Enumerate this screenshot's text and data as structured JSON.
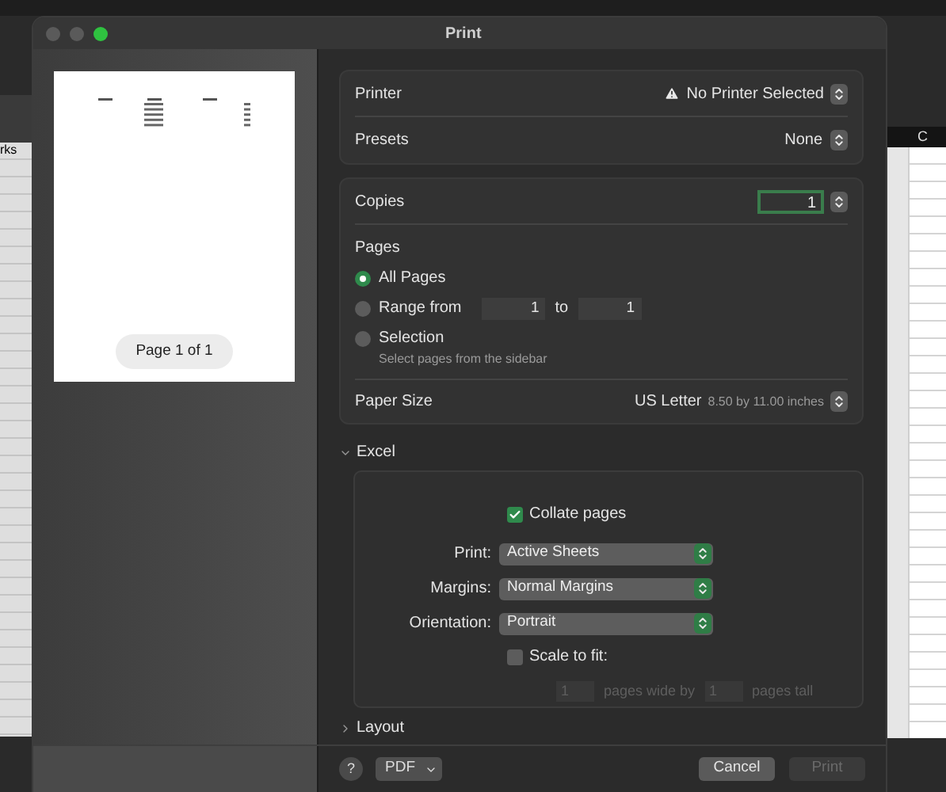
{
  "window": {
    "title": "Print"
  },
  "background": {
    "left_cell": "rks",
    "right_header": "C"
  },
  "preview": {
    "page_label": "Page 1 of 1"
  },
  "printer": {
    "label": "Printer",
    "value": "No Printer Selected",
    "warning": true
  },
  "presets": {
    "label": "Presets",
    "value": "None"
  },
  "copies": {
    "label": "Copies",
    "value": "1",
    "focused": true
  },
  "pages": {
    "label": "Pages",
    "options": [
      {
        "label": "All Pages",
        "selected": true
      },
      {
        "label": "Range from",
        "selected": false
      },
      {
        "label": "Selection",
        "selected": false,
        "hint": "Select pages from the sidebar"
      }
    ],
    "range_from": "1",
    "range_to_label": "to",
    "range_to": "1"
  },
  "paper_size": {
    "label": "Paper Size",
    "value": "US Letter",
    "detail": "8.50 by 11.00 inches"
  },
  "excel": {
    "title": "Excel",
    "expanded": true,
    "collate": {
      "label": "Collate pages",
      "checked": true
    },
    "selects": [
      {
        "label": "Print:",
        "value": "Active Sheets"
      },
      {
        "label": "Margins:",
        "value": "Normal Margins"
      },
      {
        "label": "Orientation:",
        "value": "Portrait"
      }
    ],
    "scale_to_fit": {
      "label": "Scale to fit:",
      "checked": false
    },
    "fit": {
      "disabled": true,
      "wide": "1",
      "wide_label": "pages wide by",
      "tall": "1",
      "tall_label": "pages tall"
    }
  },
  "layout": {
    "title": "Layout",
    "expanded": false
  },
  "footer": {
    "help": "?",
    "pdf": "PDF",
    "cancel": "Cancel",
    "print": {
      "label": "Print",
      "disabled": true
    }
  }
}
